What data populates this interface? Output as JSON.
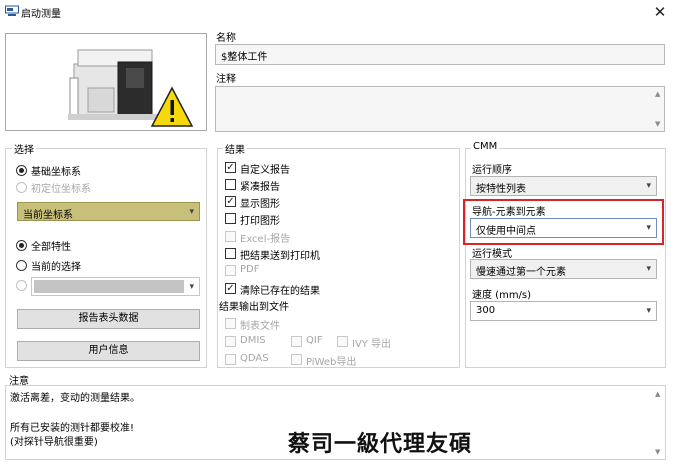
{
  "window": {
    "title": "启动测量",
    "close_glyph": "✕"
  },
  "name_section": {
    "label": "名称",
    "value": "$整体工件"
  },
  "comment_section": {
    "label": "注释",
    "value": ""
  },
  "selection": {
    "title": "选择",
    "basic_coordinate_system": "基础坐标系",
    "initial_alignment": "初定位坐标系",
    "coordinate_dropdown_value": "当前坐标系",
    "all_characteristics": "全部特性",
    "current_selection": "当前的选择",
    "report_header_button": "报告表头数据",
    "user_info_button": "用户信息"
  },
  "results": {
    "title": "结果",
    "items": [
      {
        "label": "自定义报告",
        "checked": true,
        "enabled": true
      },
      {
        "label": "紧凑报告",
        "checked": false,
        "enabled": true
      },
      {
        "label": "显示图形",
        "checked": true,
        "enabled": true
      },
      {
        "label": "打印图形",
        "checked": false,
        "enabled": true
      },
      {
        "label": "Excel-报告",
        "checked": false,
        "enabled": false
      },
      {
        "label": "把结果送到打印机",
        "checked": false,
        "enabled": true
      },
      {
        "label": "PDF",
        "checked": false,
        "enabled": false
      },
      {
        "label": "清除已存在的结果",
        "checked": true,
        "enabled": true
      }
    ],
    "output_title": "结果输出到文件",
    "table_file": "制表文件",
    "dmis": "DMIS",
    "qif": "QIF",
    "ivy": "IVY 导出",
    "qdas": "QDAS",
    "piweb": "PiWeb导出"
  },
  "cmm": {
    "title": "CMM",
    "run_order_label": "运行顺序",
    "run_order_value": "按特性列表",
    "navigation_label": "导航-元素到元素",
    "navigation_value": "仅使用中间点",
    "run_mode_label": "运行模式",
    "run_mode_value": "慢速通过第一个元素",
    "speed_label": "速度 (mm/s)",
    "speed_value": "300"
  },
  "notes": {
    "title": "注意",
    "line1": "激活离差，变动的测量结果。",
    "line2": "所有已安装的测针都要校准!",
    "line3": "(对探针导航很重要)"
  },
  "watermark": "蔡司一級代理友碩",
  "colors": {
    "highlight_box": "#d9252a",
    "dropdown_olive": "#c8c07a",
    "warning_yellow": "#f5d90a"
  }
}
